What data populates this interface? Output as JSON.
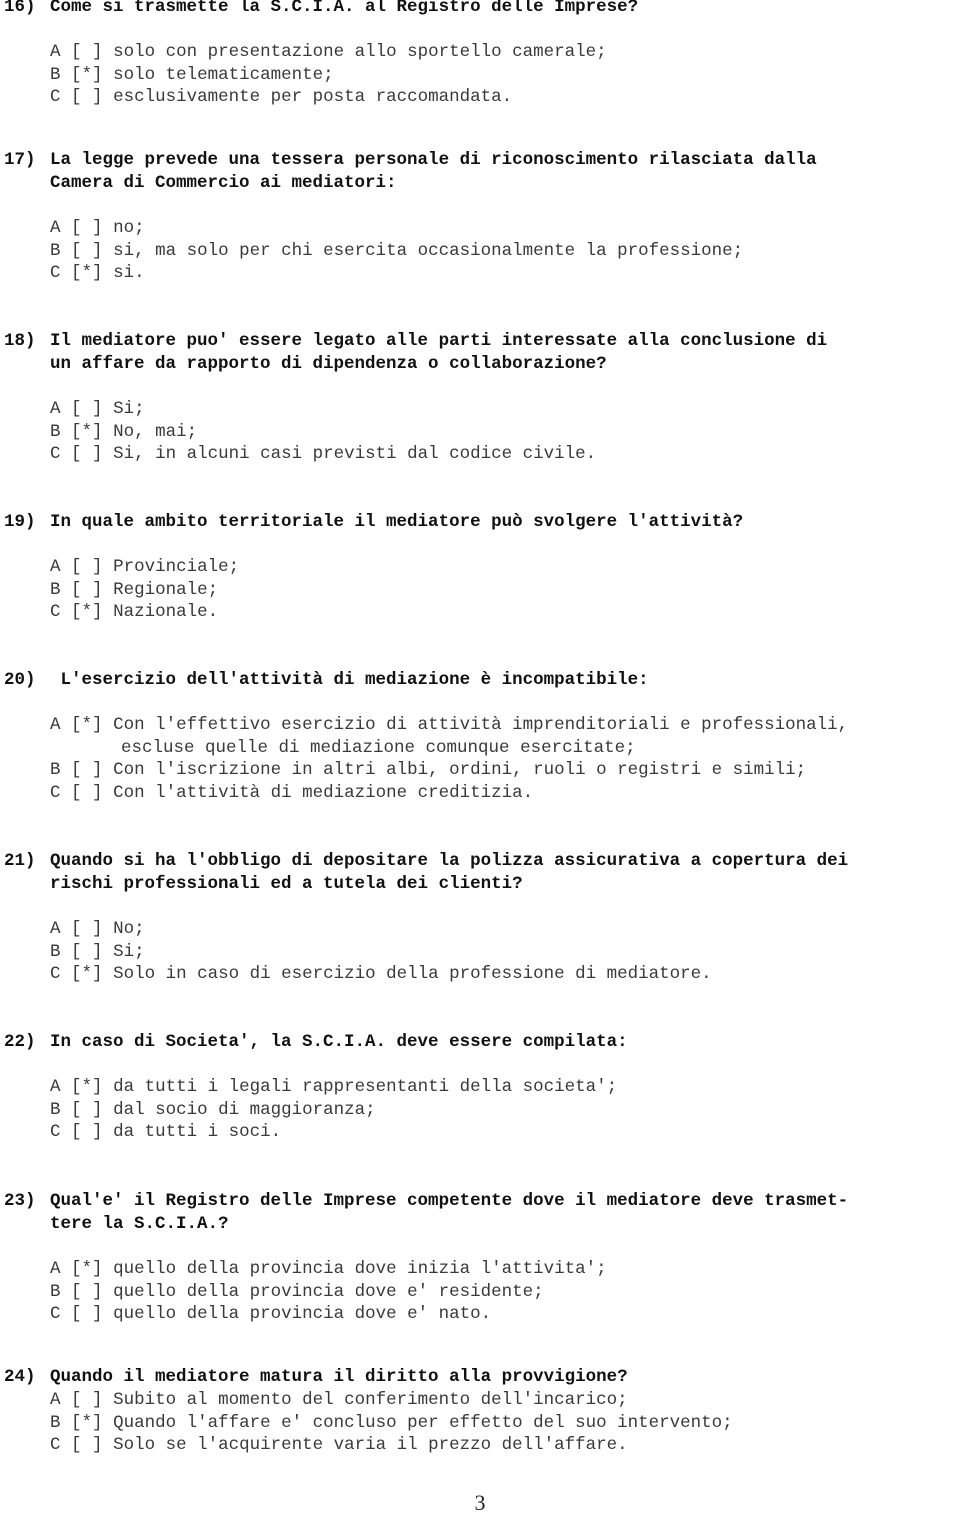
{
  "questions": [
    {
      "number": "16)",
      "text_lines": [
        "Come si trasmette la S.C.I.A. al Registro delle Imprese?"
      ],
      "options": [
        {
          "letter": "A",
          "mark": "[ ]",
          "lines": [
            "solo con presentazione allo sportello camerale;"
          ]
        },
        {
          "letter": "B",
          "mark": "[*]",
          "lines": [
            "solo telematicamente;"
          ]
        },
        {
          "letter": "C",
          "mark": "[ ]",
          "lines": [
            "esclusivamente per posta raccomandata."
          ]
        }
      ]
    },
    {
      "number": "17)",
      "text_lines": [
        "La legge prevede una tessera personale di riconoscimento rilasciata dalla",
        "Camera di Commercio ai mediatori:"
      ],
      "options": [
        {
          "letter": "A",
          "mark": "[ ]",
          "lines": [
            "no;"
          ]
        },
        {
          "letter": "B",
          "mark": "[ ]",
          "lines": [
            "si, ma solo per chi esercita occasionalmente la professione;"
          ]
        },
        {
          "letter": "C",
          "mark": "[*]",
          "lines": [
            "si."
          ]
        }
      ]
    },
    {
      "number": "18)",
      "text_lines": [
        "Il mediatore puo′ essere legato alle parti interessate alla conclusione di",
        "un affare da rapporto di dipendenza o collaborazione?"
      ],
      "options": [
        {
          "letter": "A",
          "mark": "[ ]",
          "lines": [
            "Si;"
          ]
        },
        {
          "letter": "B",
          "mark": "[*]",
          "lines": [
            "No, mai;"
          ]
        },
        {
          "letter": "C",
          "mark": "[ ]",
          "lines": [
            "Si, in alcuni casi previsti dal codice civile."
          ]
        }
      ]
    },
    {
      "number": "19)",
      "text_lines": [
        "In quale ambito territoriale il mediatore può svolgere l'attività?"
      ],
      "options": [
        {
          "letter": "A",
          "mark": "[ ]",
          "lines": [
            "Provinciale;"
          ]
        },
        {
          "letter": "B",
          "mark": "[ ]",
          "lines": [
            "Regionale;"
          ]
        },
        {
          "letter": "C",
          "mark": "[*]",
          "lines": [
            "Nazionale."
          ]
        }
      ]
    },
    {
      "number": "20)",
      "text_lines": [
        " L'esercizio dell'attività di mediazione è incompatibile:"
      ],
      "options": [
        {
          "letter": "A",
          "mark": "[*]",
          "lines": [
            "Con l'effettivo esercizio di attività imprenditoriali e professionali,",
            "escluse quelle di mediazione comunque esercitate;"
          ]
        },
        {
          "letter": "B",
          "mark": "[ ]",
          "lines": [
            "Con l'iscrizione in altri albi, ordini, ruoli o registri e simili;"
          ]
        },
        {
          "letter": "C",
          "mark": "[ ]",
          "lines": [
            "Con l'attività di mediazione creditizia."
          ]
        }
      ]
    },
    {
      "number": "21)",
      "text_lines": [
        "Quando si ha l'obbligo di depositare la polizza assicurativa a copertura dei",
        "rischi professionali ed a tutela dei clienti?"
      ],
      "options": [
        {
          "letter": "A",
          "mark": "[ ]",
          "lines": [
            "No;"
          ]
        },
        {
          "letter": "B",
          "mark": "[ ]",
          "lines": [
            "Si;"
          ]
        },
        {
          "letter": "C",
          "mark": "[*]",
          "lines": [
            "Solo in caso di esercizio della professione di mediatore."
          ]
        }
      ]
    },
    {
      "number": "22)",
      "text_lines": [
        "In caso di Societa′, la S.C.I.A. deve essere compilata:"
      ],
      "options": [
        {
          "letter": "A",
          "mark": "[*]",
          "lines": [
            "da tutti i legali rappresentanti della societa′;"
          ]
        },
        {
          "letter": "B",
          "mark": "[ ]",
          "lines": [
            "dal socio di maggioranza;"
          ]
        },
        {
          "letter": "C",
          "mark": "[ ]",
          "lines": [
            "da tutti i soci."
          ]
        }
      ]
    },
    {
      "number": "23)",
      "text_lines": [
        "Qual′e′ il Registro delle Imprese competente dove il mediatore deve trasmet-",
        "tere la S.C.I.A.?"
      ],
      "options": [
        {
          "letter": "A",
          "mark": "[*]",
          "lines": [
            "quello della provincia dove inizia l′attivita′;"
          ]
        },
        {
          "letter": "B",
          "mark": "[ ]",
          "lines": [
            "quello della provincia dove e′ residente;"
          ]
        },
        {
          "letter": "C",
          "mark": "[ ]",
          "lines": [
            "quello della provincia dove e′ nato."
          ]
        }
      ]
    },
    {
      "number": "24)",
      "text_lines": [
        "Quando il mediatore matura il diritto alla provvigione?"
      ],
      "options": [
        {
          "letter": "A",
          "mark": "[ ]",
          "lines": [
            "Subito al momento del conferimento dell′incarico;"
          ]
        },
        {
          "letter": "B",
          "mark": "[*]",
          "lines": [
            "Quando l′affare e′ concluso per effetto del suo intervento;"
          ]
        },
        {
          "letter": "C",
          "mark": "[ ]",
          "lines": [
            "Solo se l′acquirente varia il prezzo dell′affare."
          ]
        }
      ]
    }
  ],
  "page_number": "3"
}
